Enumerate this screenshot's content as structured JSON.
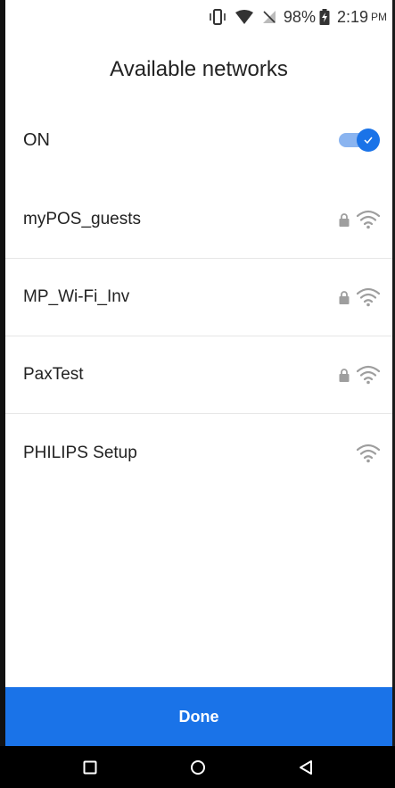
{
  "status_bar": {
    "battery_percent": "98%",
    "time": "2:19",
    "ampm": "PM",
    "icons": [
      "vibrate-icon",
      "wifi-signal-icon",
      "no-signal-icon",
      "battery-charging-icon"
    ]
  },
  "header": {
    "title": "Available networks"
  },
  "wifi_toggle": {
    "label": "ON",
    "state": true,
    "accent_color": "#1a73e8"
  },
  "networks": [
    {
      "name": "myPOS_guests",
      "secured": true,
      "icon": "wifi-icon"
    },
    {
      "name": "MP_Wi-Fi_Inv",
      "secured": true,
      "icon": "wifi-icon"
    },
    {
      "name": "PaxTest",
      "secured": true,
      "icon": "wifi-icon"
    },
    {
      "name": "PHILIPS Setup",
      "secured": false,
      "icon": "wifi-icon"
    }
  ],
  "footer": {
    "done_label": "Done"
  },
  "nav_bar": {
    "buttons": [
      "recent-apps-icon",
      "home-icon",
      "back-icon"
    ]
  }
}
